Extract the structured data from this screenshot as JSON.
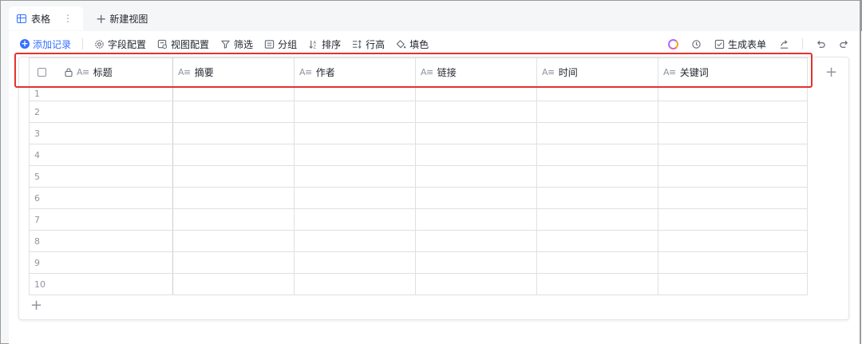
{
  "tabs": {
    "active_label": "表格",
    "more": "⋮",
    "new_view_label": "新建视图"
  },
  "toolbar": {
    "add_record": "添加记录",
    "field_config": "字段配置",
    "view_config": "视图配置",
    "filter": "筛选",
    "group": "分组",
    "sort": "排序",
    "row_height": "行高",
    "fill_color": "填色",
    "generate_form": "生成表单"
  },
  "grid": {
    "columns": [
      {
        "label": "标题",
        "type_icon": "A≡"
      },
      {
        "label": "摘要",
        "type_icon": "A≡"
      },
      {
        "label": "作者",
        "type_icon": "A≡"
      },
      {
        "label": "链接",
        "type_icon": "A≡"
      },
      {
        "label": "时间",
        "type_icon": "A≡"
      },
      {
        "label": "关键词",
        "type_icon": "A≡"
      }
    ],
    "rows": [
      "1",
      "2",
      "3",
      "4",
      "5",
      "6",
      "7",
      "8",
      "9",
      "10"
    ],
    "add_column": "+",
    "add_row": "+"
  },
  "colors": {
    "accent": "#3370ff",
    "highlight": "#e5322d"
  }
}
